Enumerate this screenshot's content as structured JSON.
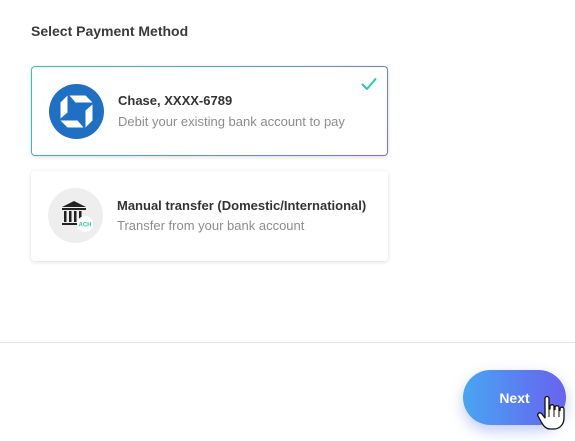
{
  "heading": "Select Payment Method",
  "methods": [
    {
      "title": "Chase, XXXX-6789",
      "subtitle": "Debit your existing bank account to pay",
      "icon": "chase-logo-icon",
      "selected": true,
      "brand_color": "#1f6fc2"
    },
    {
      "title": "Manual transfer (Domestic/International)",
      "subtitle": "Transfer from your bank account",
      "icon": "bank-building-icon",
      "badge": "ACH",
      "selected": false
    }
  ],
  "footer": {
    "next_label": "Next"
  },
  "colors": {
    "accent_start": "#49a5f2",
    "accent_end": "#6a63ee",
    "check": "#2ec9a8"
  }
}
